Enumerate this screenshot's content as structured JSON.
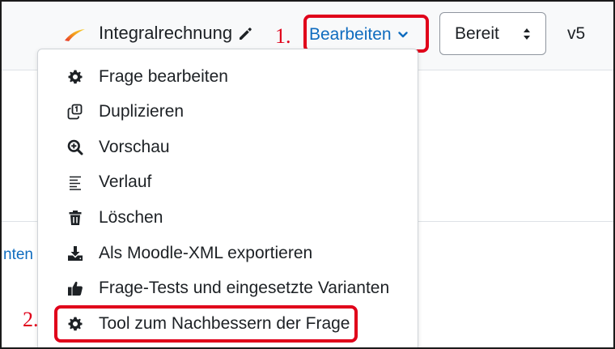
{
  "header": {
    "question_title": "Integralrechnung",
    "edit_label": "Bearbeiten",
    "status_value": "Bereit",
    "version": "v5"
  },
  "annotations": {
    "step1": "1.",
    "step2": "2."
  },
  "menu": {
    "items": [
      {
        "label": "Frage bearbeiten",
        "icon": "gear-icon"
      },
      {
        "label": "Duplizieren",
        "icon": "copy-icon"
      },
      {
        "label": "Vorschau",
        "icon": "search-plus-icon"
      },
      {
        "label": "Verlauf",
        "icon": "history-lines-icon"
      },
      {
        "label": "Löschen",
        "icon": "trash-icon"
      },
      {
        "label": "Als Moodle-XML exportieren",
        "icon": "download-icon"
      },
      {
        "label": "Frage-Tests und eingesetzte Varianten",
        "icon": "thumbs-up-icon"
      },
      {
        "label": "Tool zum Nachbessern der Frage",
        "icon": "gear-icon"
      }
    ]
  },
  "background": {
    "partial_link": "nten"
  },
  "colors": {
    "link": "#0f6cbf",
    "highlight": "#e0001a",
    "text": "#1d2125"
  }
}
